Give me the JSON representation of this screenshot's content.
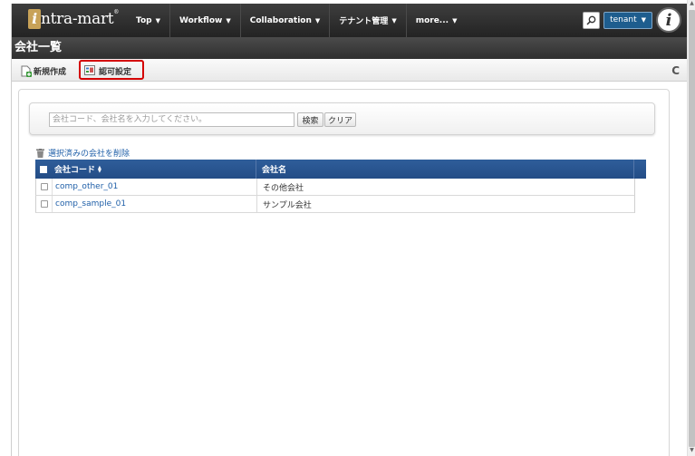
{
  "nav": {
    "logo": "ntra-mart",
    "logo_glyph": "i",
    "logo_mark": "®",
    "menu": [
      {
        "label": "Top"
      },
      {
        "label": "Workflow"
      },
      {
        "label": "Collaboration"
      },
      {
        "label": "テナント管理"
      },
      {
        "label": "more..."
      }
    ],
    "tenant_label": "tenant",
    "badge_glyph": "i"
  },
  "page": {
    "title": "会社一覧"
  },
  "toolbar": {
    "new_label": "新規作成",
    "auth_label": "認可設定",
    "highlight_color": "#d40000"
  },
  "search": {
    "placeholder": "会社コード、会社名を入力してください。",
    "search_label": "検索",
    "clear_label": "クリア"
  },
  "delete_link": "選択済みの会社を削除",
  "table": {
    "columns": [
      "会社コード",
      "会社名"
    ],
    "rows": [
      {
        "code": "comp_other_01",
        "name": "その他会社"
      },
      {
        "code": "comp_sample_01",
        "name": "サンプル会社"
      }
    ]
  },
  "colors": {
    "header_blue": "#2a5690",
    "link_blue": "#1f5fa8",
    "tenant_blue": "#1e5d8e"
  }
}
